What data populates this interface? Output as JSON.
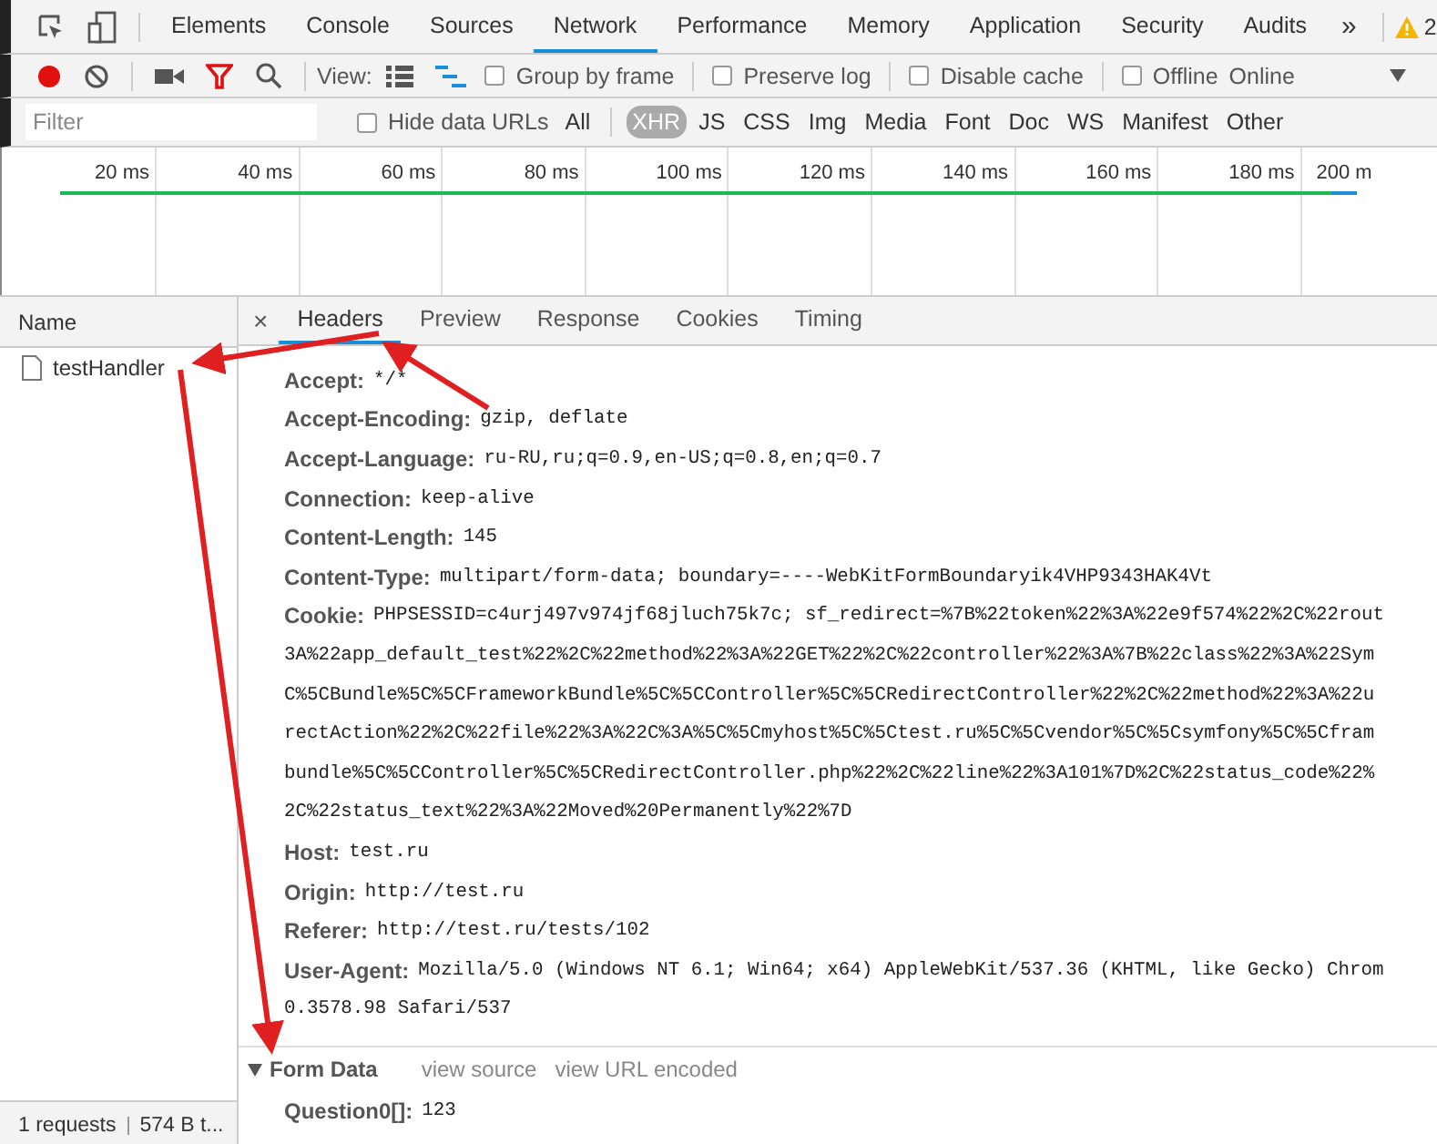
{
  "panel_tabs": [
    {
      "label": "Elements",
      "selected": false
    },
    {
      "label": "Console",
      "selected": false
    },
    {
      "label": "Sources",
      "selected": false
    },
    {
      "label": "Network",
      "selected": true
    },
    {
      "label": "Performance",
      "selected": false
    },
    {
      "label": "Memory",
      "selected": false
    },
    {
      "label": "Application",
      "selected": false
    },
    {
      "label": "Security",
      "selected": false
    },
    {
      "label": "Audits",
      "selected": false
    }
  ],
  "more_tabs": "»",
  "warning_count": "2",
  "toolbar": {
    "recording": true,
    "filter_on": true,
    "view_label": "View:",
    "large_rows": false,
    "waterfall": true,
    "checkboxes": [
      {
        "label": "Group by frame",
        "checked": false
      },
      {
        "label": "Preserve log",
        "checked": false
      },
      {
        "label": "Disable cache",
        "checked": false
      },
      {
        "label": "Offline",
        "checked": false
      }
    ],
    "throttling": "Online"
  },
  "filter_bar": {
    "placeholder": "Filter",
    "hide_data_urls": {
      "label": "Hide data URLs",
      "checked": false
    },
    "types": [
      {
        "label": "All",
        "selected": false
      },
      {
        "label": "XHR",
        "selected": true
      },
      {
        "label": "JS",
        "selected": false
      },
      {
        "label": "CSS",
        "selected": false
      },
      {
        "label": "Img",
        "selected": false
      },
      {
        "label": "Media",
        "selected": false
      },
      {
        "label": "Font",
        "selected": false
      },
      {
        "label": "Doc",
        "selected": false
      },
      {
        "label": "WS",
        "selected": false
      },
      {
        "label": "Manifest",
        "selected": false
      },
      {
        "label": "Other",
        "selected": false
      }
    ]
  },
  "timeline": {
    "ticks": [
      "20 ms",
      "40 ms",
      "60 ms",
      "80 ms",
      "100 ms",
      "120 ms",
      "140 ms",
      "160 ms",
      "180 ms",
      "200 m"
    ]
  },
  "requests": {
    "column": "Name",
    "rows": [
      {
        "name": "testHandler"
      }
    ],
    "status": [
      "1 requests",
      "574 B t..."
    ]
  },
  "detail": {
    "close": "×",
    "tabs": [
      {
        "label": "Headers",
        "selected": true
      },
      {
        "label": "Preview",
        "selected": false
      },
      {
        "label": "Response",
        "selected": false
      },
      {
        "label": "Cookies",
        "selected": false
      },
      {
        "label": "Timing",
        "selected": false
      }
    ],
    "headers": [
      {
        "name": "Accept:",
        "lines": [
          "*/*"
        ]
      },
      {
        "name": "Accept-Encoding:",
        "lines": [
          "gzip, deflate"
        ]
      },
      {
        "name": "Accept-Language:",
        "lines": [
          "ru-RU,ru;q=0.9,en-US;q=0.8,en;q=0.7"
        ]
      },
      {
        "name": "Connection:",
        "lines": [
          "keep-alive"
        ]
      },
      {
        "name": "Content-Length:",
        "lines": [
          "145"
        ]
      },
      {
        "name": "Content-Type:",
        "lines": [
          "multipart/form-data; boundary=----WebKitFormBoundaryik4VHP9343HAK4Vt"
        ]
      },
      {
        "name": "Cookie:",
        "lines": [
          "PHPSESSID=c4urj497v974jf68jluch75k7c; sf_redirect=%7B%22token%22%3A%22e9f574%22%2C%22rout",
          "3A%22app_default_test%22%2C%22method%22%3A%22GET%22%2C%22controller%22%3A%7B%22class%22%3A%22Sym",
          "C%5CBundle%5C%5CFrameworkBundle%5C%5CController%5C%5CRedirectController%22%2C%22method%22%3A%22u",
          "rectAction%22%2C%22file%22%3A%22C%3A%5C%5Cmyhost%5C%5Ctest.ru%5C%5Cvendor%5C%5Csymfony%5C%5Cfram",
          "bundle%5C%5CController%5C%5CRedirectController.php%22%2C%22line%22%3A101%7D%2C%22status_code%22%",
          "2C%22status_text%22%3A%22Moved%20Permanently%22%7D"
        ]
      },
      {
        "name": "Host:",
        "lines": [
          "test.ru"
        ]
      },
      {
        "name": "Origin:",
        "lines": [
          "http://test.ru"
        ]
      },
      {
        "name": "Referer:",
        "lines": [
          "http://test.ru/tests/102"
        ]
      },
      {
        "name": "User-Agent:",
        "lines": [
          "Mozilla/5.0 (Windows NT 6.1; Win64; x64) AppleWebKit/537.36 (KHTML, like Gecko) Chrom",
          "0.3578.98 Safari/537"
        ]
      }
    ],
    "form_data": {
      "title": "Form Data",
      "expanded": true,
      "links": [
        "view source",
        "view URL encoded"
      ],
      "fields": [
        {
          "name": "Question0[]:",
          "value": "123"
        }
      ]
    }
  }
}
